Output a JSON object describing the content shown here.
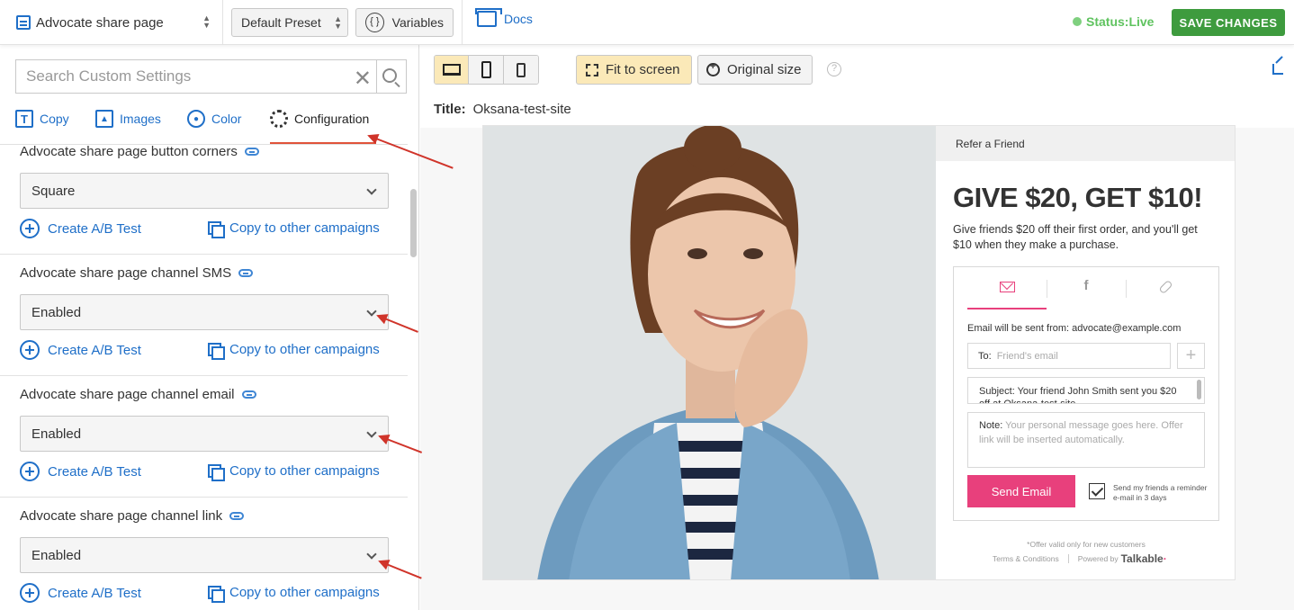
{
  "topbar": {
    "page_select": "Advocate share page",
    "preset": "Default Preset",
    "variables": "Variables",
    "docs": "Docs",
    "status": "Status:Live",
    "save": "SAVE CHANGES"
  },
  "sidebar": {
    "search_placeholder": "Search Custom Settings",
    "tabs": [
      {
        "label": "Copy",
        "icon": "text-icon"
      },
      {
        "label": "Images",
        "icon": "image-icon"
      },
      {
        "label": "Color",
        "icon": "drop-icon"
      },
      {
        "label": "Configuration",
        "icon": "gear-icon",
        "active": true
      }
    ],
    "settings": [
      {
        "label": "Advocate share page button corners",
        "value": "Square"
      },
      {
        "label": "Advocate share page channel SMS",
        "value": "Enabled"
      },
      {
        "label": "Advocate share page channel email",
        "value": "Enabled"
      },
      {
        "label": "Advocate share page channel link",
        "value": "Enabled"
      }
    ],
    "ab_test": "Create A/B Test",
    "copy_campaigns": "Copy to other campaigns"
  },
  "preview": {
    "fit": "Fit to screen",
    "original": "Original size",
    "help": "?",
    "title_label": "Title:",
    "title_value": "Oksana-test-site",
    "widget": {
      "refer": "Refer a Friend",
      "headline": "GIVE $20, GET $10!",
      "subtext": "Give friends $20 off their first order, and you'll get $10 when they make a purchase.",
      "facebook": "f",
      "from": "Email will be sent from: advocate@example.com",
      "to_label": "To:",
      "to_placeholder": "Friend's email",
      "add": "+",
      "subject": "Subject: Your friend John Smith sent you $20 off at Oksana-test-site",
      "note_label": "Note:",
      "note_placeholder": "Your personal message goes here. Offer link will be inserted automatically.",
      "send": "Send Email",
      "reminder": "Send my friends a reminder e-mail in 3 days",
      "offer": "*Offer valid only for new customers",
      "terms": "Terms & Conditions",
      "powered": "Powered by",
      "brand": "Talkable"
    }
  },
  "colors": {
    "accent_blue": "#1f6fc8",
    "save_green": "#3e9b3e",
    "status_green": "#5fc35f",
    "pink": "#e8407c",
    "annotation_red": "#d0342a"
  }
}
